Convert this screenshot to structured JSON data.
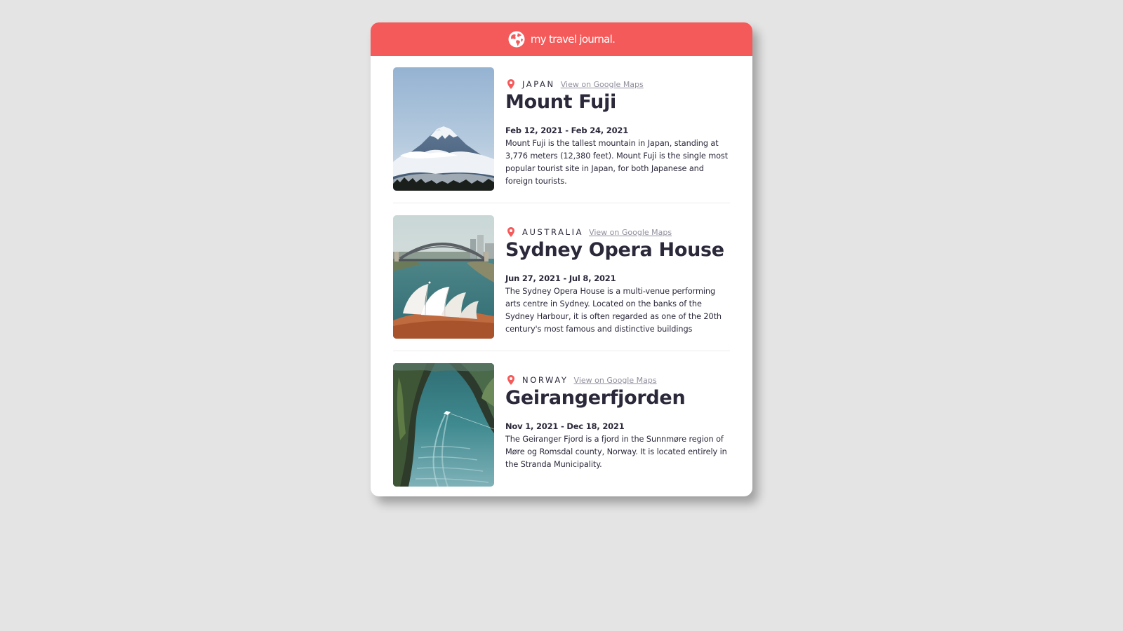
{
  "header": {
    "title": "my travel journal.",
    "icon": "globe-icon",
    "background": "#f55a5a"
  },
  "entries": [
    {
      "country": "JAPAN",
      "maps_link": "View on Google Maps",
      "title": "Mount Fuji",
      "dates": "Feb 12, 2021 - Feb 24, 2021",
      "description": "Mount Fuji is the tallest mountain in Japan, standing at 3,776 meters (12,380 feet). Mount Fuji is the single most popular tourist site in Japan, for both Japanese and foreign tourists.",
      "photo": "mount-fuji-photo"
    },
    {
      "country": "AUSTRALIA",
      "maps_link": "View on Google Maps",
      "title": "Sydney Opera House",
      "dates": "Jun 27, 2021 - Jul 8, 2021",
      "description": "The Sydney Opera House is a multi-venue performing arts centre in Sydney. Located on the banks of the Sydney Harbour, it is often regarded as one of the 20th century's most famous and distinctive buildings",
      "photo": "sydney-opera-house-photo"
    },
    {
      "country": "NORWAY",
      "maps_link": "View on Google Maps",
      "title": "Geirangerfjorden",
      "dates": "Nov 1, 2021 - Dec 18, 2021",
      "description": "The Geiranger Fjord is a fjord in the Sunnmøre region of Møre og Romsdal county, Norway. It is located entirely in the Stranda Municipality.",
      "photo": "geirangerfjorden-photo"
    }
  ],
  "colors": {
    "accent": "#f55a5a",
    "text": "#2b283a",
    "muted": "#918e9b",
    "page_background": "#e4e4e4"
  }
}
